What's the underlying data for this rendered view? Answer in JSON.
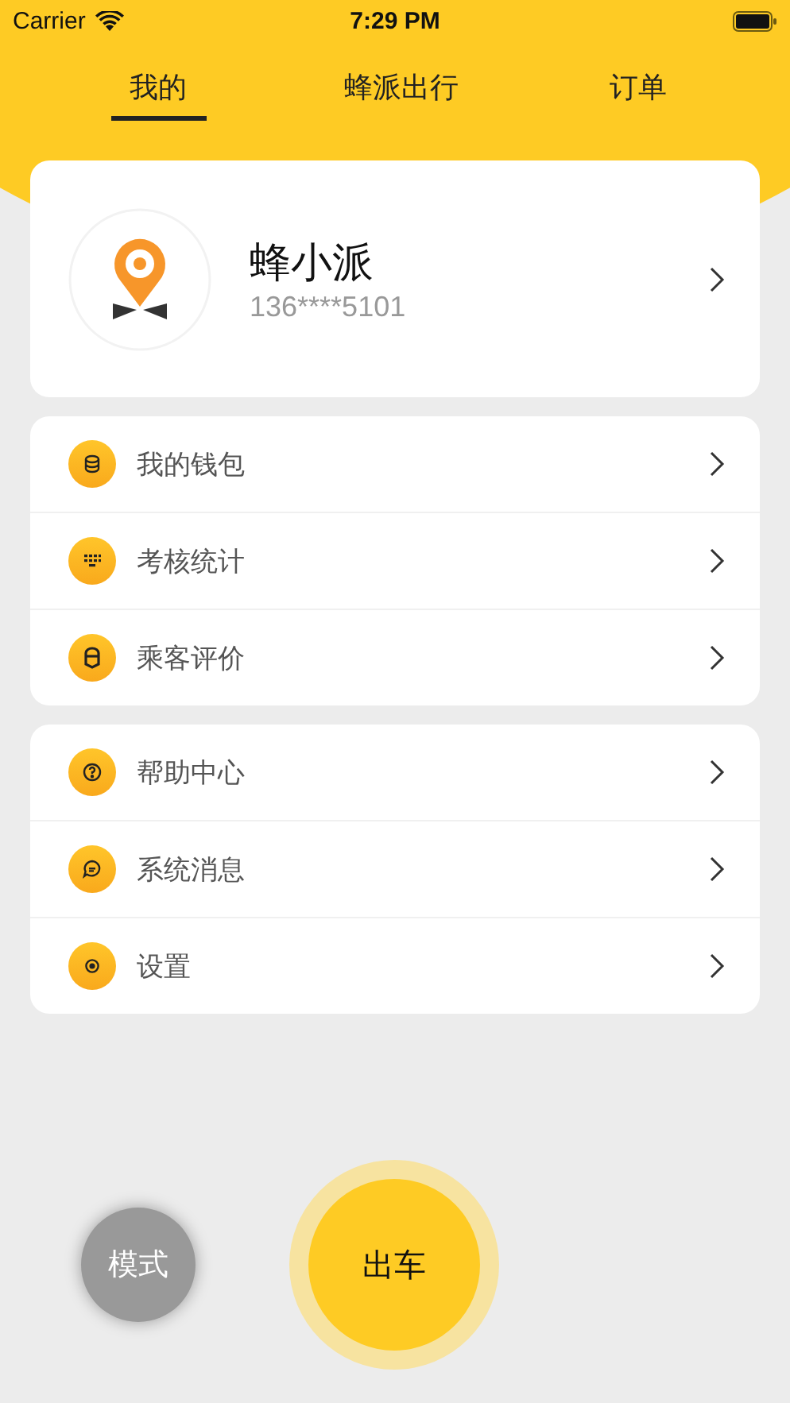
{
  "status_bar": {
    "carrier": "Carrier",
    "time": "7:29 PM"
  },
  "tabs": [
    {
      "label": "我的",
      "selected": true
    },
    {
      "label": "蜂派出行",
      "selected": false
    },
    {
      "label": "订单",
      "selected": false
    }
  ],
  "profile": {
    "name": "蜂小派",
    "phone": "136****5101"
  },
  "menu_groups": [
    {
      "items": [
        {
          "kind": "wallet",
          "label": "我的钱包"
        },
        {
          "kind": "stats",
          "label": "考核统计"
        },
        {
          "kind": "rating",
          "label": "乘客评价"
        }
      ]
    },
    {
      "items": [
        {
          "kind": "help",
          "label": "帮助中心"
        },
        {
          "kind": "message",
          "label": "系统消息"
        },
        {
          "kind": "settings",
          "label": "设置"
        }
      ]
    }
  ],
  "mode_button": "模式",
  "depart_button": "出车"
}
